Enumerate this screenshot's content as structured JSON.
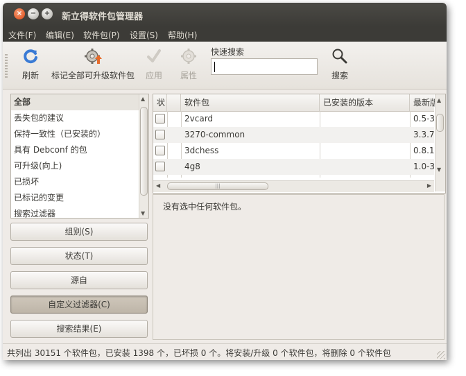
{
  "window": {
    "title": "新立得软件包管理器",
    "buttons": {
      "close": "×",
      "minimize": "−",
      "maximize": "+"
    }
  },
  "menubar": [
    {
      "label": "文件(F)"
    },
    {
      "label": "编辑(E)"
    },
    {
      "label": "软件包(P)"
    },
    {
      "label": "设置(S)"
    },
    {
      "label": "帮助(H)"
    }
  ],
  "toolbar": {
    "reload": {
      "label": "刷新",
      "icon": "refresh-icon"
    },
    "mark_all": {
      "label": "标记全部可升级软件包",
      "icon": "upgrade-gear-icon"
    },
    "apply": {
      "label": "应用",
      "icon": "checkmark-icon",
      "disabled": true
    },
    "properties": {
      "label": "属性",
      "icon": "gear-icon",
      "disabled": true
    },
    "quick_search": {
      "label": "快速搜索",
      "value": ""
    },
    "search": {
      "label": "搜索",
      "icon": "magnifier-icon"
    }
  },
  "sidebar": {
    "items": [
      {
        "label": "全部",
        "selected": true
      },
      {
        "label": "丢失包的建议"
      },
      {
        "label": "保持一致性（已安装的）"
      },
      {
        "label": "具有 Debconf 的包"
      },
      {
        "label": "可升级(向上)"
      },
      {
        "label": "已损坏"
      },
      {
        "label": "已标记的变更"
      },
      {
        "label": "搜索过滤器"
      }
    ],
    "filter_buttons": [
      {
        "label": "组别(S)"
      },
      {
        "label": "状态(T)"
      },
      {
        "label": "源自"
      },
      {
        "label": "自定义过滤器(C)",
        "active": true
      },
      {
        "label": "搜索结果(E)"
      }
    ]
  },
  "package_table": {
    "columns": [
      "状",
      "",
      "软件包",
      "已安装的版本",
      "最新版本"
    ],
    "rows": [
      {
        "name": "2vcard",
        "installed": "",
        "latest": "0.5-3"
      },
      {
        "name": "3270-common",
        "installed": "",
        "latest": "3.3.7"
      },
      {
        "name": "3dchess",
        "installed": "",
        "latest": "0.8.1"
      },
      {
        "name": "4g8",
        "installed": "",
        "latest": "1.0-3"
      }
    ]
  },
  "details": {
    "text": "没有选中任何软件包。"
  },
  "status": {
    "text": "共列出 30151 个软件包，已安装 1398 个，已坏损 0 个。将安装/升级 0 个软件包，将删除 0 个软件包"
  },
  "colors": {
    "titlebar": "#3c3b37",
    "close_button": "#dd4814",
    "background": "#efebe7"
  }
}
